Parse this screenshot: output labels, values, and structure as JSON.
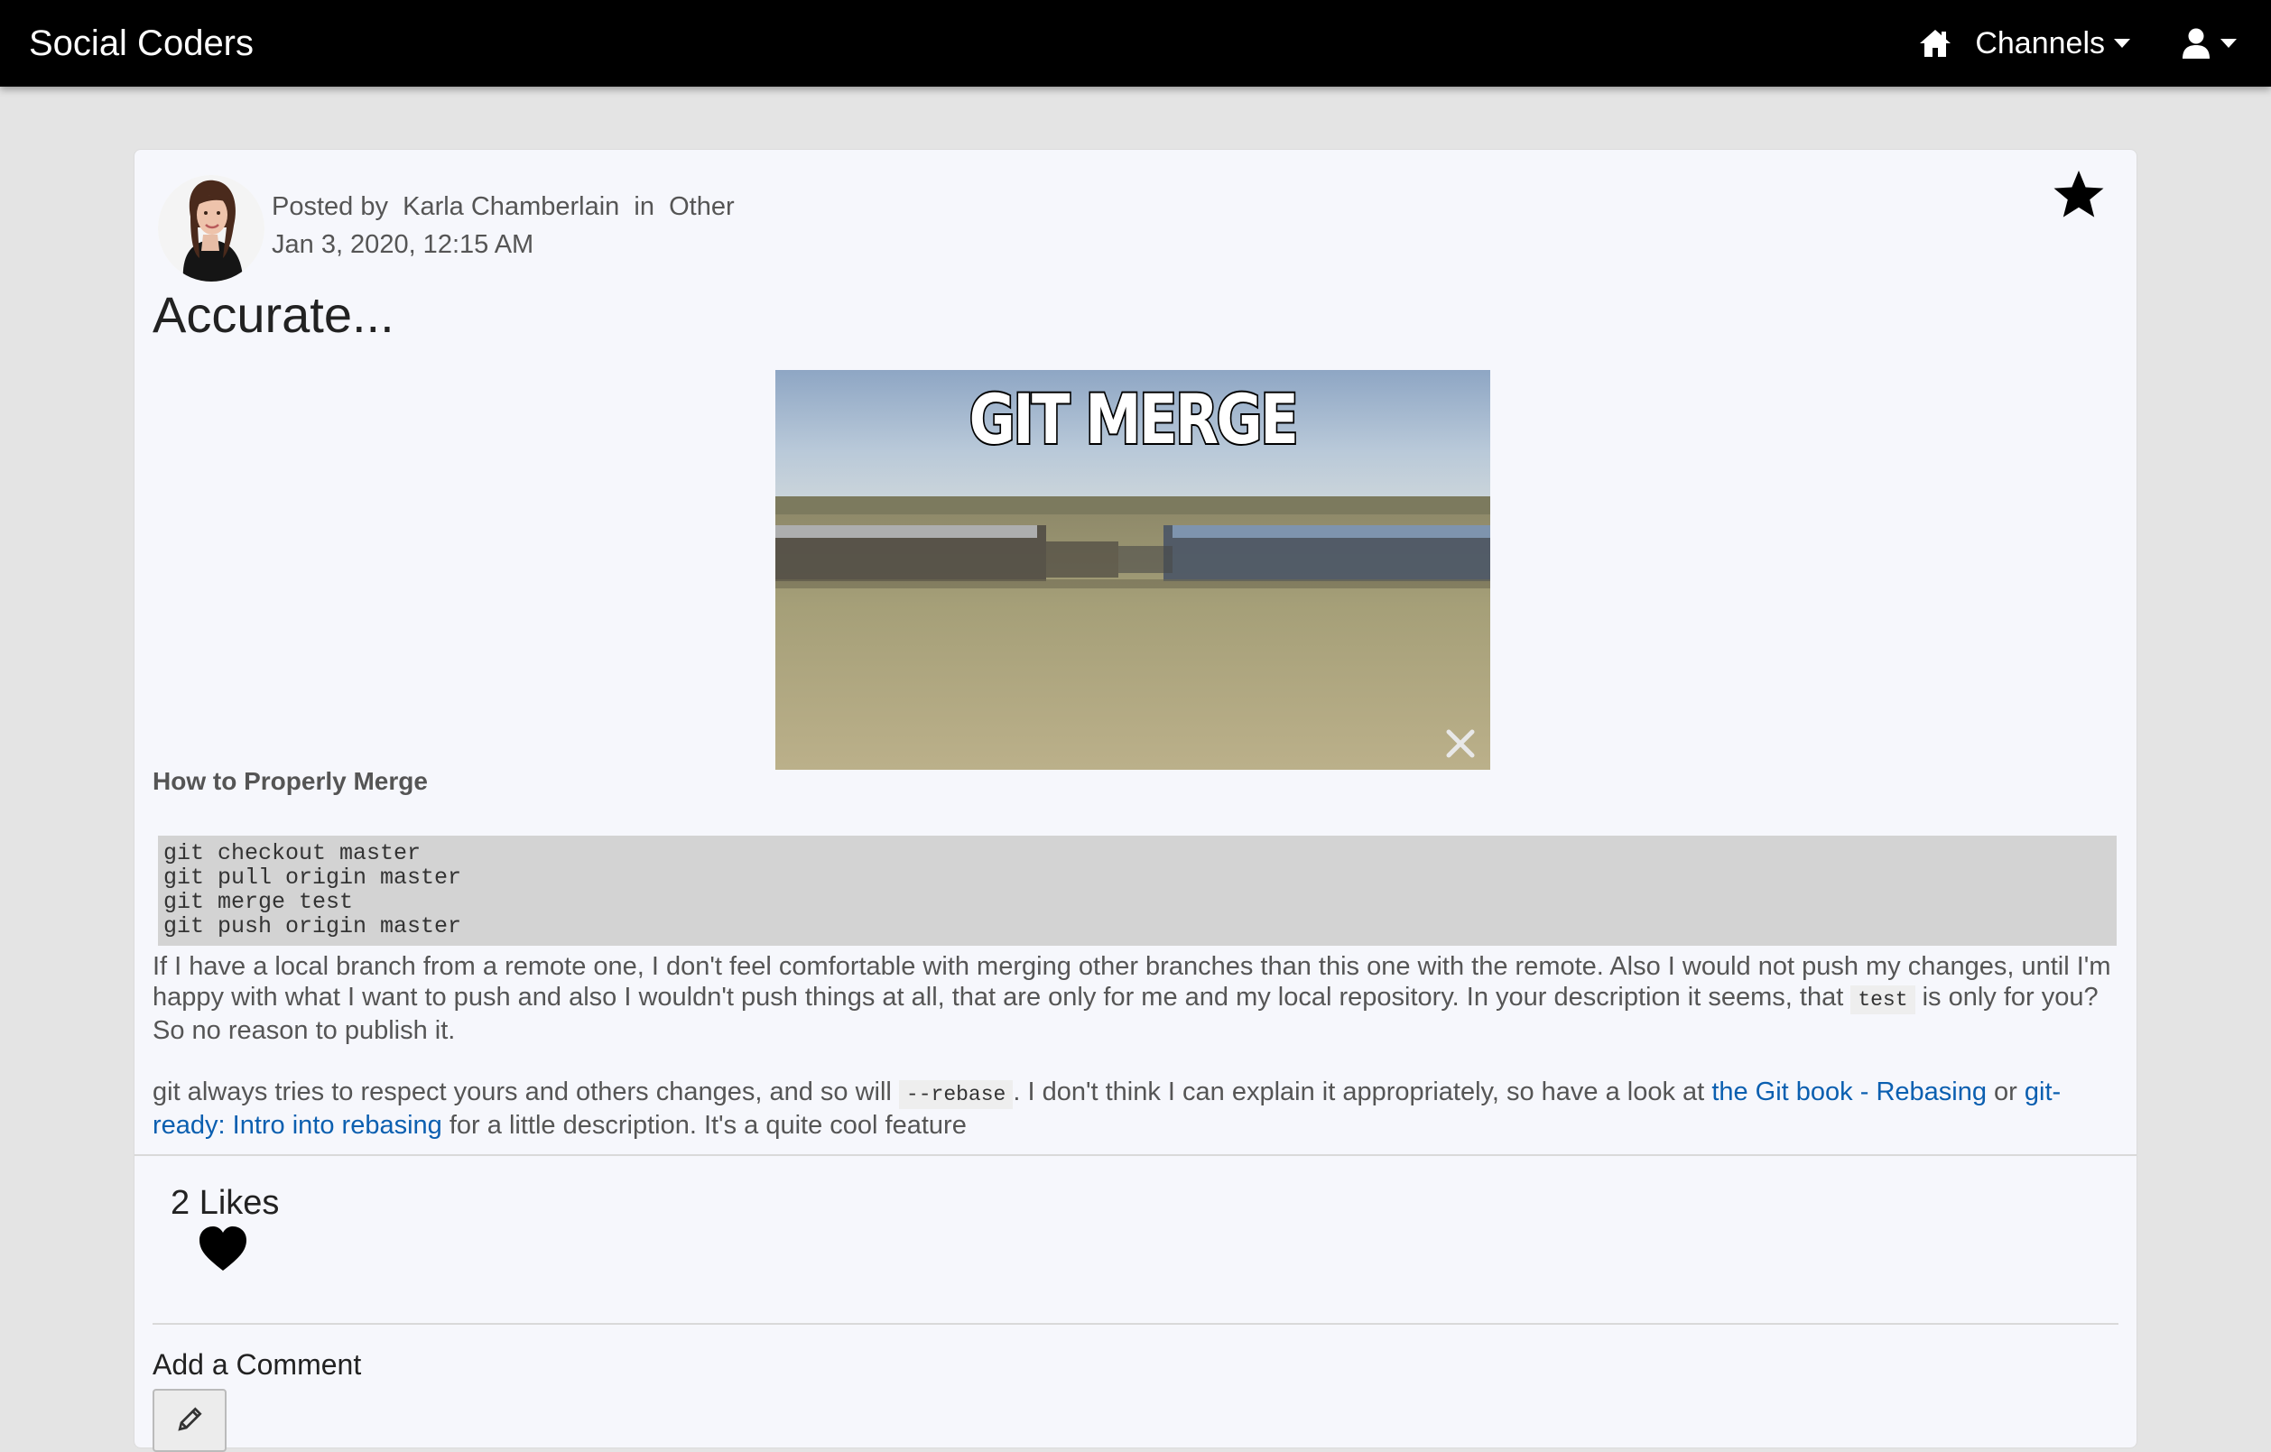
{
  "navbar": {
    "brand": "Social Coders",
    "home_icon": "home-icon",
    "channels_label": "Channels",
    "user_icon": "user-icon"
  },
  "post": {
    "posted_by_label": "Posted by",
    "author": "Karla Chamberlain",
    "in_label": "in",
    "channel": "Other",
    "timestamp": "Jan 3, 2020, 12:15 AM",
    "title": "Accurate...",
    "favorite_icon": "star-icon",
    "gif": {
      "caption": "GIT MERGE",
      "close_icon": "close-icon"
    },
    "section_heading": "How to Properly Merge",
    "code_lines": [
      "git checkout master",
      "git pull origin master",
      "git merge test",
      "git push origin master"
    ],
    "paragraph1": {
      "before": "If I have a local branch from a remote one, I don't feel comfortable with merging other branches than this one with the remote. Also I would not push my changes, until I'm happy with what I want to push and also I wouldn't push things at all, that are only for me and my local repository. In your description it seems, that",
      "code": "test",
      "after": "is only for you? So no reason to publish it."
    },
    "paragraph2": {
      "before": "git always tries to respect yours and others changes, and so will",
      "code": "--rebase",
      "middle": ". I don't think I can explain it appropriately, so have a look at",
      "link1": "the Git book - Rebasing",
      "or_text": "or",
      "link2": "git-ready: Intro into rebasing",
      "after": "for a little description. It's a quite cool feature"
    },
    "likes_text": "2 Likes",
    "like_icon": "heart-icon",
    "comment_heading": "Add a Comment",
    "comment_icon": "pencil-icon"
  },
  "colors": {
    "navbar_bg": "#000000",
    "page_bg": "#e4e4e4",
    "card_bg": "#f6f7fc",
    "link": "#0b5fb0",
    "code_bg": "#d3d3d3"
  }
}
